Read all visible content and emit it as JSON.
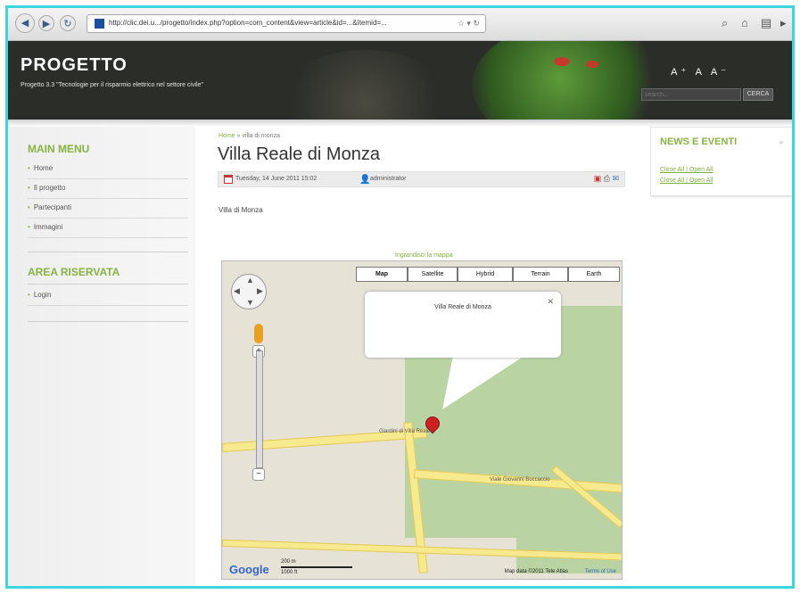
{
  "browser": {
    "url": "http://clic.dei.u.../progetto/index.php?option=com_content&view=article&id=...&Itemid=...",
    "icons": {
      "back": "back-arrow-icon",
      "forward": "forward-arrow-icon",
      "reload": "reload-icon",
      "home": "home-icon"
    }
  },
  "header": {
    "title": "PROGETTO",
    "subtitle": "Progetto 3.3 \"Tecnologie per il risparmio elettrico nel settore civile\"",
    "search_placeholder": "search...",
    "search_button": "CERCA",
    "icons": "A⁺ A A⁻"
  },
  "sidebar": {
    "main_menu_heading": "MAIN MENU",
    "main_menu": [
      "Home",
      "Il progetto",
      "Partecipanti",
      "Immagini"
    ],
    "reserved_heading": "AREA RISERVATA",
    "reserved_menu": [
      "Login"
    ]
  },
  "article": {
    "breadcrumb_home": "Home",
    "breadcrumb_sep": "»",
    "breadcrumb_current": "villa di monza",
    "title": "Villa Reale di Monza",
    "date": "Tuesday, 14 June 2011 15:02",
    "author": "administrator",
    "body": "Villa di Monza",
    "map_link": "Ingrandisci la mappa"
  },
  "map": {
    "types": [
      "Map",
      "Satellite",
      "Hybrid",
      "Terrain",
      "Earth"
    ],
    "selected_type": "Map",
    "info_title": "Villa Reale di Monza",
    "labels": {
      "villa": "Giardini di Villa Reale",
      "road": "Viale Giovanni Boccaccio"
    },
    "scale_top": "200 m",
    "scale_bottom": "1000 ft",
    "attribution": "Map data ©2011 Tele Atlas",
    "terms": "Terms of Use",
    "google": "Google"
  },
  "news": {
    "heading": "NEWS E EVENTI",
    "lines": [
      "Close All | Open All",
      "Close All | Open All"
    ]
  }
}
